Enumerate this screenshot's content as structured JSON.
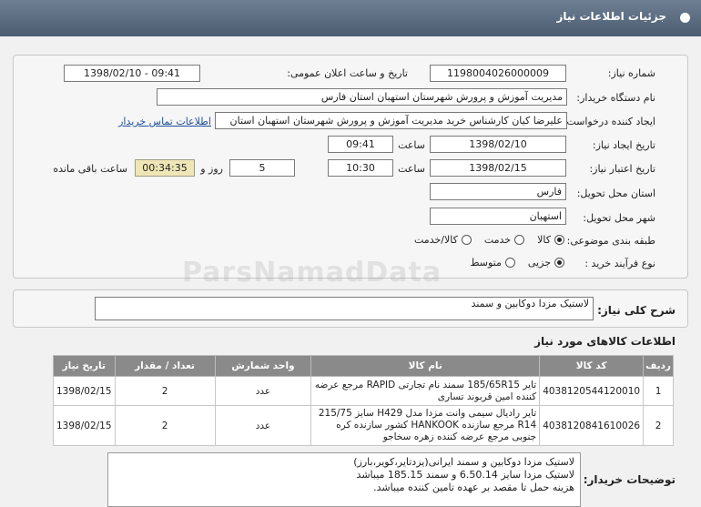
{
  "header": {
    "title": "جزئیات اطلاعات نیاز"
  },
  "watermark": "ParsNamadData",
  "form": {
    "need_number": {
      "label": "شماره نیاز:",
      "value": "1198004026000009"
    },
    "announce_datetime": {
      "label": "تاریخ و ساعت اعلان عمومی:",
      "value": "1398/02/10 - 09:41"
    },
    "buyer_org": {
      "label": "نام دستگاه خریدار:",
      "value": "مدیریت آموزش و پرورش شهرستان استهبان استان فارس"
    },
    "requester": {
      "label": "ایجاد کننده درخواست:",
      "value": "علیرضا کیان کارشناس خرید مدیریت آموزش و پرورش شهرستان استهبان استان",
      "contact_link": "اطلاعات تماس خریدار"
    },
    "create_date": {
      "label": "تاریخ ایجاد نیاز:",
      "date": "1398/02/10",
      "time_label": "ساعت",
      "time": "09:41"
    },
    "validity": {
      "label": "تاریخ اعتبار نیاز:",
      "date": "1398/02/15",
      "time_label": "ساعت",
      "time": "10:30",
      "days": "5",
      "days_label": "روز و",
      "remaining": "00:34:35",
      "remaining_label": "ساعت باقی مانده"
    },
    "province": {
      "label": "استان محل تحویل:",
      "value": "فارس"
    },
    "city": {
      "label": "شهر محل تحویل:",
      "value": "استهبان"
    },
    "category": {
      "label": "طبقه بندی موضوعی:",
      "options": [
        "کالا",
        "خدمت",
        "کالا/خدمت"
      ],
      "selected": "کالا"
    },
    "purchase_type": {
      "label": "نوع فرآیند خرید :",
      "options": [
        "جزیی",
        "متوسط"
      ],
      "selected": "جزیی"
    }
  },
  "summary": {
    "label": "شرح کلی نیاز:",
    "value": "لاستیک مزدا دوکابین و سمند"
  },
  "items_title": "اطلاعات کالاهای مورد نیاز",
  "table": {
    "headers": [
      "ردیف",
      "کد کالا",
      "نام کالا",
      "واحد شمارش",
      "تعداد / مقدار",
      "تاریخ نیاز"
    ],
    "rows": [
      {
        "row": "1",
        "code": "4038120544120010",
        "name": "تایر 185/65R15 سمند نام تجارتی RAPID مرجع عرضه کننده امین قربوند تساری",
        "unit": "عدد",
        "qty": "2",
        "date": "1398/02/15"
      },
      {
        "row": "2",
        "code": "4038120841610026",
        "name": "تایر رادیال سیمی وانت مزدا مدل H429 سایز 215/75 R14 مرجع سازنده HANKOOK کشور سازنده کره جنوبی مرجع عرضه کننده زهره سخاجو",
        "unit": "عدد",
        "qty": "2",
        "date": "1398/02/15"
      }
    ]
  },
  "buyer_notes": {
    "label": "توضیحات خریدار:",
    "lines": [
      "لاستیک مزدا دوکابین و سمند ایرانی(یزدتایر،کویر،بارز)",
      "لاستیک مزدا سایز 6.50.14  و سمند  185.15 میباشد",
      "هزینه حمل تا مقصد بر عهده تامین کننده میباشد."
    ]
  }
}
